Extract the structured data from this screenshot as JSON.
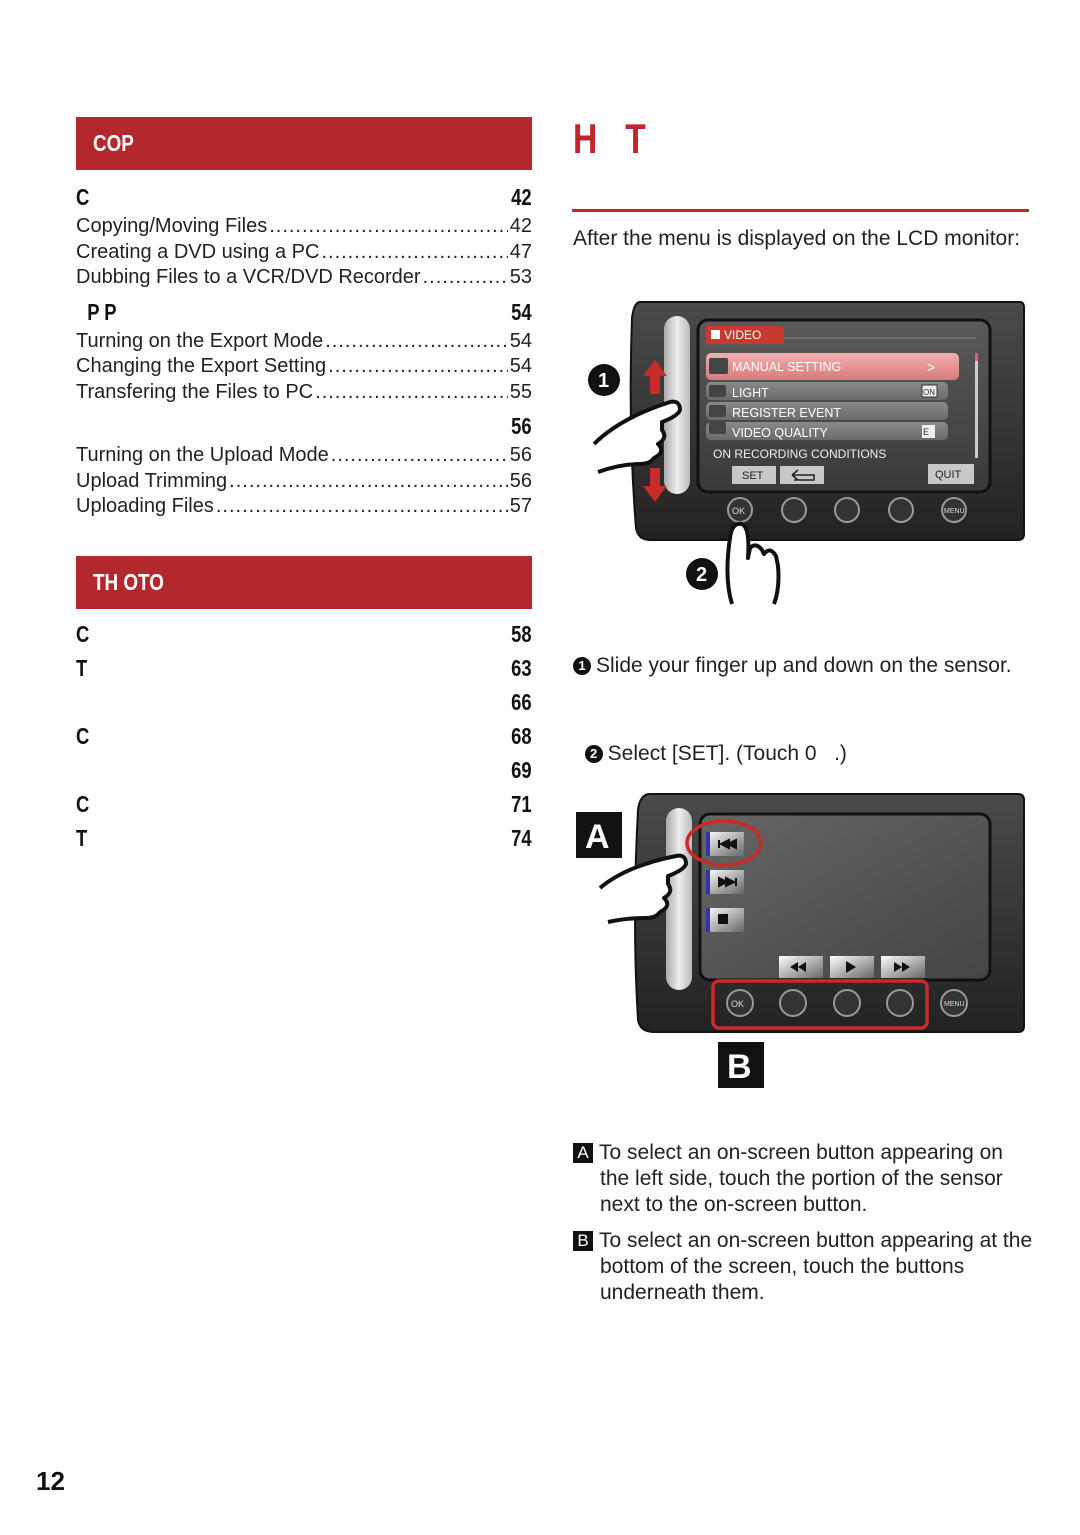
{
  "left_column": {
    "sections": [
      {
        "title": "COP",
        "groups": [
          {
            "heading": "C",
            "page": "42",
            "items": [
              {
                "label": "Copying/Moving Files",
                "page": "42"
              },
              {
                "label": "Creating a DVD using a PC",
                "page": "47"
              },
              {
                "label": "Dubbing Files to a VCR/DVD Recorder",
                "page": "53"
              }
            ]
          },
          {
            "heading": "P P",
            "page": "54",
            "items": [
              {
                "label": "Turning on the Export Mode",
                "page": "54"
              },
              {
                "label": "Changing the Export Setting",
                "page": "54"
              },
              {
                "label": "Transfering the Files to PC",
                "page": "55"
              }
            ]
          },
          {
            "heading": "",
            "page": "56",
            "items": [
              {
                "label": "Turning on the Upload Mode",
                "page": "56"
              },
              {
                "label": "Upload Trimming",
                "page": "56"
              },
              {
                "label": "Uploading Files",
                "page": "57"
              }
            ]
          }
        ]
      },
      {
        "title": "TH OTO",
        "groups": [
          {
            "heading": "C",
            "page": "58"
          },
          {
            "heading": "T",
            "page": "63"
          },
          {
            "heading": "",
            "page": "66"
          },
          {
            "heading": "C",
            "page": "68"
          },
          {
            "heading": "",
            "page": "69"
          },
          {
            "heading": "C",
            "page": "71"
          },
          {
            "heading": "T",
            "page": "74"
          }
        ]
      }
    ]
  },
  "right_column": {
    "title": "H   T",
    "intro": "After the menu is displayed on the LCD monitor:",
    "lcd_menu": {
      "tab": "VIDEO",
      "items": [
        {
          "icon": "manual-setting-icon",
          "label": "MANUAL SETTING",
          "badge": ">",
          "selected": true
        },
        {
          "icon": "light-icon",
          "label": "LIGHT",
          "badge": "ON"
        },
        {
          "icon": "register-event-icon",
          "label": "REGISTER EVENT",
          "badge": ""
        },
        {
          "icon": "video-quality-icon",
          "label": "VIDEO QUALITY",
          "badge": "E"
        }
      ],
      "hint": "ON RECORDING CONDITIONS",
      "buttons": {
        "set": "SET",
        "back": "⮌",
        "quit": "QUIT"
      },
      "hw_buttons": {
        "ok": "OK",
        "menu": "MENU"
      }
    },
    "callouts": {
      "one": "1",
      "two": "2",
      "a": "A",
      "b": "B"
    },
    "steps": [
      {
        "num": "1",
        "text": "Slide your finger up and down on the sensor."
      },
      {
        "num": "2",
        "text": "Select [SET]. (Touch 0   .)"
      }
    ],
    "notes": [
      {
        "letter": "A",
        "text": "To select an on-screen button appearing on the left side, touch the portion of the sensor next to the on-screen button."
      },
      {
        "letter": "B",
        "text": "To select an on-screen button appearing at the bottom of the screen, touch the buttons underneath them."
      }
    ],
    "playback_buttons": {
      "left": [
        "skip-back",
        "skip-forward",
        "stop"
      ],
      "bottom": [
        "rewind",
        "play",
        "fast-forward"
      ]
    }
  },
  "footer": {
    "page_number": "12"
  },
  "colors": {
    "accent_red": "#b3282f",
    "title_red": "#c4242b"
  }
}
